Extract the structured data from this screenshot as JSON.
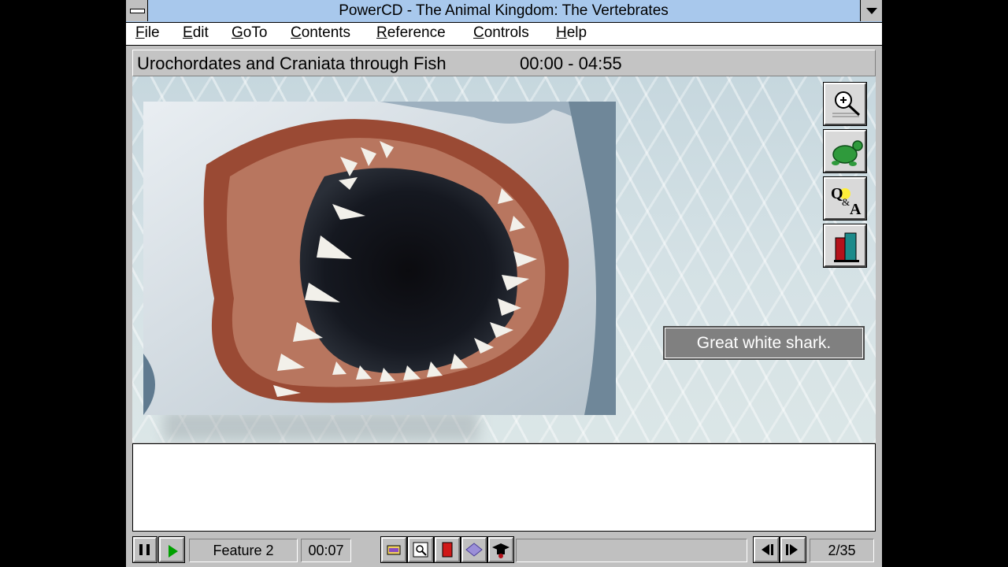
{
  "window": {
    "title": "PowerCD - The Animal Kingdom: The Vertebrates"
  },
  "menu": [
    "File",
    "Edit",
    "GoTo",
    "Contents",
    "Reference",
    "Controls",
    "Help"
  ],
  "header": {
    "section": "Urochordates and Craniata through Fish",
    "time_range": "00:00 - 04:55"
  },
  "caption": "Great white shark.",
  "sidebar": [
    {
      "name": "zoom-button",
      "icon": "magnifier-icon"
    },
    {
      "name": "turtle-button",
      "icon": "turtle-icon"
    },
    {
      "name": "qa-button",
      "icon": "q-and-a-icon"
    },
    {
      "name": "books-button",
      "icon": "books-icon"
    }
  ],
  "controls": {
    "feature_label": "Feature 2",
    "elapsed": "00:07",
    "page": "2/35",
    "icons": [
      "pause-icon",
      "play-icon",
      "film-icon",
      "magnifier-page-icon",
      "red-book-icon",
      "map-icon",
      "graduation-cap-icon",
      "previous-icon",
      "next-icon"
    ]
  },
  "colors": {
    "titlebar": "#a8c8ec",
    "play_green": "#00a000",
    "caption_bg": "#808080"
  }
}
